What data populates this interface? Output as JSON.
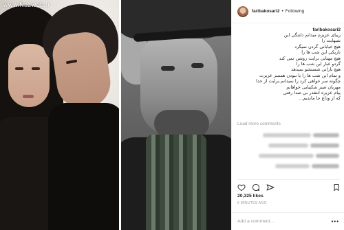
{
  "watermark": "www.Nazweb.ir",
  "header": {
    "username": "faribakosari2",
    "separator": "•",
    "follow_status": "Following"
  },
  "caption": {
    "username": "faribakosari2",
    "lines": [
      "زیبای عزیزم میدانم دلتنگی این",
      "شبهایت را",
      "هیچ خیابانی گردن نمیگرد",
      "تاریکی این شب ها را",
      "هیچ مهتابی برایت روشن نمی کند",
      "گردو غبار این شب ها را",
      "هیچ بارانی شستشو نمیدهد",
      "و تمام این شب ها را با نبودن همسر عزیزت",
      "چگونه سر خواهی کرد را نمیدانم.برایت از خدا",
      "مهربان صبر شکیبایی خواهانم",
      "پیام عزیزه انتقدر بی صدا رفتی",
      "...که از وداع جا ماندیم"
    ]
  },
  "load_more": "Load more comments",
  "likes": "20,325 likes",
  "timestamp": "6 MINUTES AGO",
  "comment_placeholder": "Add a comment...",
  "comment_more": "•••",
  "icons": [
    "heart-icon",
    "comment-icon",
    "share-icon",
    "bookmark-icon"
  ]
}
